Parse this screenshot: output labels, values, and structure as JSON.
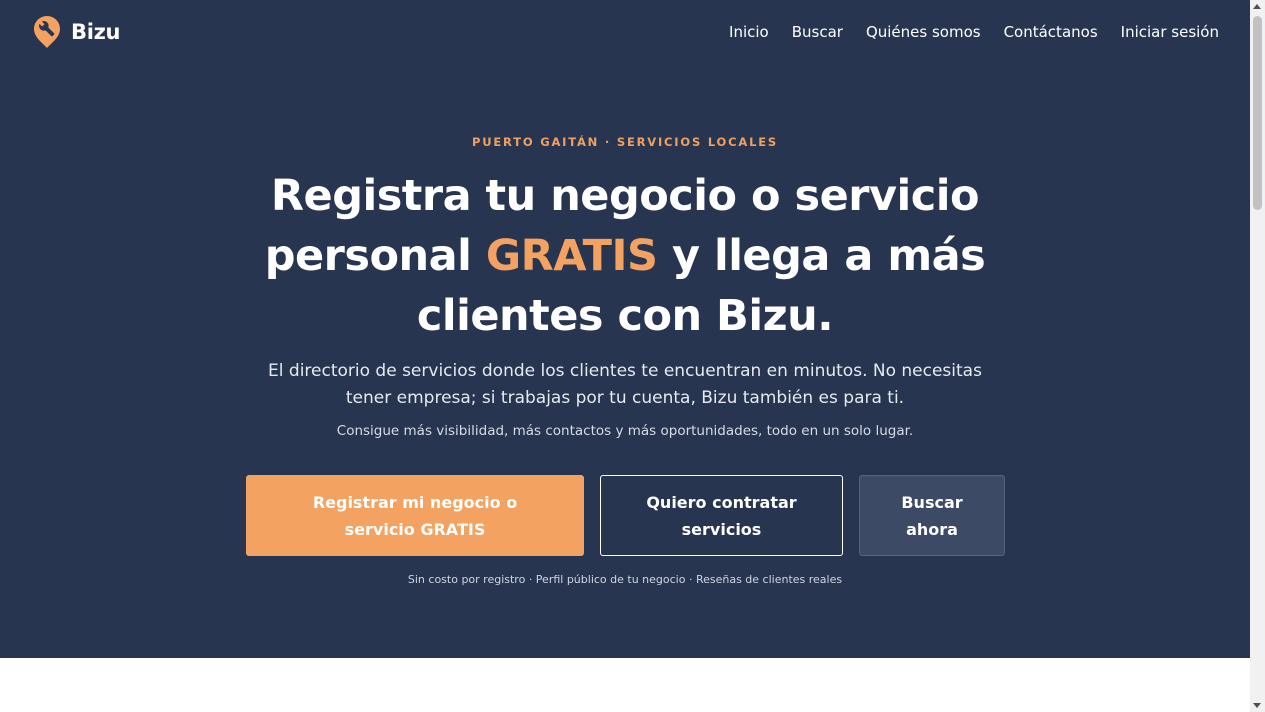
{
  "brand": {
    "name": "Bizu",
    "logo_icon": "wrench-location-pin-icon",
    "accent": "#f3a261"
  },
  "nav": {
    "items": [
      {
        "label": "Inicio"
      },
      {
        "label": "Buscar"
      },
      {
        "label": "Quiénes somos"
      },
      {
        "label": "Contáctanos"
      },
      {
        "label": "Iniciar sesión"
      }
    ]
  },
  "hero": {
    "background": "#283550",
    "eyebrow": "PUERTO GAITÁN · SERVICIOS LOCALES",
    "headline_before": "Registra tu negocio o servicio personal ",
    "headline_accent": "GRATIS",
    "headline_after": " y llega a más clientes con Bizu.",
    "lede": "El directorio de servicios donde los clientes te encuentran en minutos. No necesitas tener empresa; si trabajas por tu cuenta, Bizu también es para ti.",
    "sub": "Consigue más visibilidad, más contactos y más oportunidades, todo en un solo lugar.",
    "buttons": {
      "primary": "Registrar mi negocio o servicio GRATIS",
      "outline": "Quiero contratar servicios",
      "ghost": "Buscar ahora"
    },
    "fine_print": "Sin costo por registro · Perfil público de tu negocio · Reseñas de clientes reales"
  }
}
